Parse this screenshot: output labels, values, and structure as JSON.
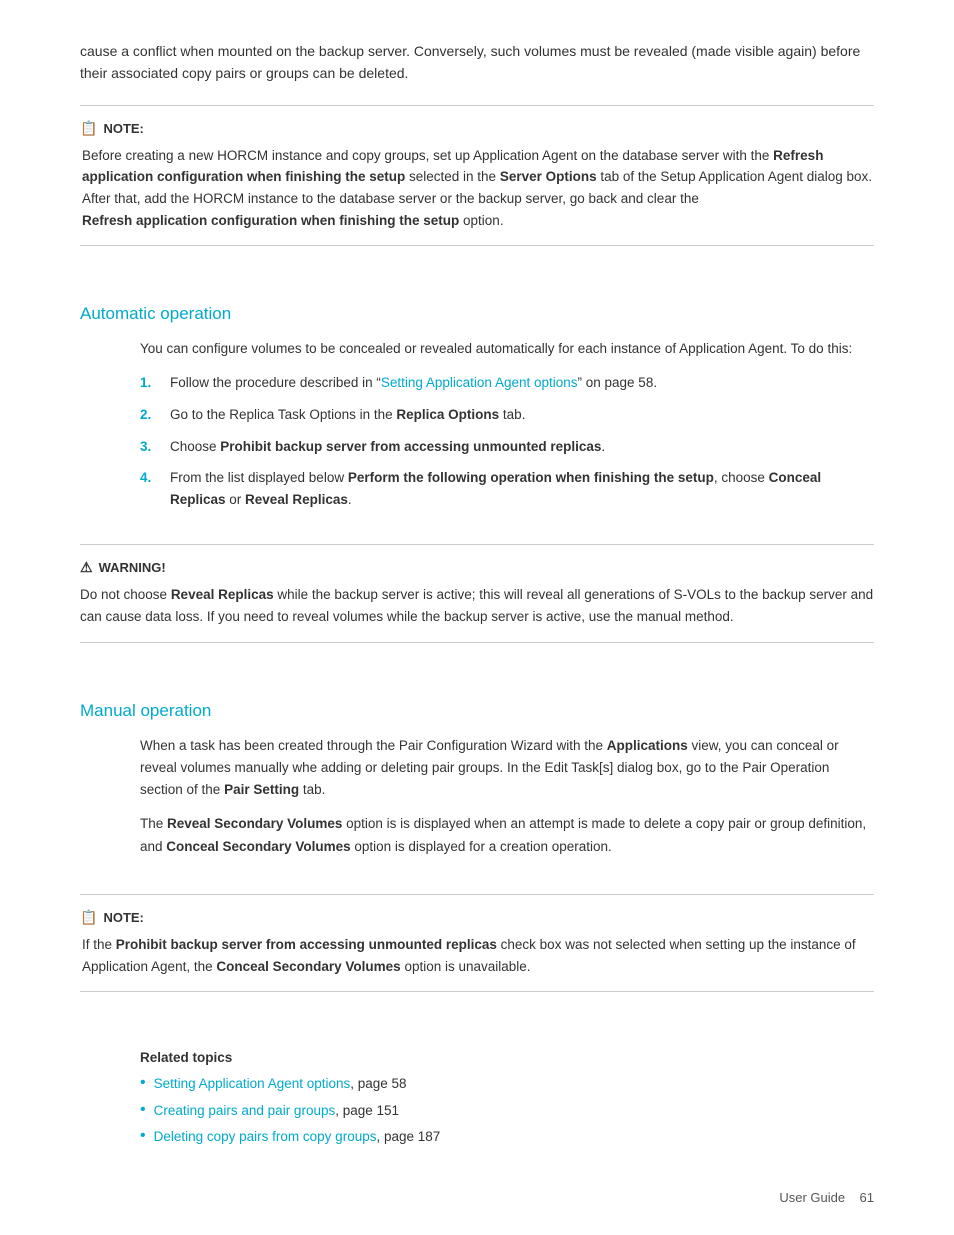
{
  "intro": {
    "text": "cause a conflict when mounted on the backup server. Conversely, such volumes must be revealed (made visible again) before their associated copy pairs or groups can be deleted."
  },
  "note1": {
    "header": "NOTE:",
    "body_parts": [
      {
        "text": "Before creating a new HORCM instance and copy groups, set up Application Agent on the database server with the "
      },
      {
        "bold": "Refresh application configuration when finishing the setup"
      },
      {
        "text": " selected in the "
      },
      {
        "bold": "Server Options"
      },
      {
        "text": " tab of the Setup Application Agent dialog box. After that, add the HORCM instance to the database server or the backup server, go back and clear the "
      },
      {
        "bold": "Refresh application configuration when finishing the setup"
      },
      {
        "text": " option."
      }
    ]
  },
  "automatic_operation": {
    "title": "Automatic operation",
    "intro": "You can configure volumes to be concealed or revealed automatically for each instance of Application Agent. To do this:",
    "steps": [
      {
        "num": "1.",
        "parts": [
          {
            "text": "Follow the procedure described in “"
          },
          {
            "link": "Setting Application Agent options"
          },
          {
            "text": "” on page 58."
          }
        ]
      },
      {
        "num": "2.",
        "parts": [
          {
            "text": "Go to the Replica Task Options in the "
          },
          {
            "bold": "Replica Options"
          },
          {
            "text": " tab."
          }
        ]
      },
      {
        "num": "3.",
        "parts": [
          {
            "text": "Choose "
          },
          {
            "bold": "Prohibit backup server from accessing unmounted replicas"
          },
          {
            "text": "."
          }
        ]
      },
      {
        "num": "4.",
        "parts": [
          {
            "text": "From the list displayed below "
          },
          {
            "bold": "Perform the following operation when finishing the setup"
          },
          {
            "text": ", choose "
          },
          {
            "bold": "Conceal Replicas"
          },
          {
            "text": " or "
          },
          {
            "bold": "Reveal Replicas"
          },
          {
            "text": "."
          }
        ]
      }
    ]
  },
  "warning1": {
    "header": "WARNING!",
    "body_parts": [
      {
        "text": "Do not choose "
      },
      {
        "bold": "Reveal Replicas"
      },
      {
        "text": " while the backup server is active; this will reveal all generations of S-VOLs to the backup server and can cause data loss. If you need to reveal volumes while the backup server is active, use the manual method."
      }
    ]
  },
  "manual_operation": {
    "title": "Manual operation",
    "para1_parts": [
      {
        "text": "When a task has been created through the Pair Configuration Wizard with the "
      },
      {
        "bold": "Applications"
      },
      {
        "text": " view, you can conceal or reveal volumes manually whe adding or deleting pair groups. In the Edit Task[s] dialog box, go to the Pair Operation section of the "
      },
      {
        "bold": "Pair Setting"
      },
      {
        "text": " tab."
      }
    ],
    "para2_parts": [
      {
        "text": "The "
      },
      {
        "bold": "Reveal Secondary Volumes"
      },
      {
        "text": " option is is displayed when an attempt is made to delete a copy pair or group definition, and "
      },
      {
        "bold": "Conceal Secondary Volumes"
      },
      {
        "text": " option is displayed for a creation operation."
      }
    ]
  },
  "note2": {
    "header": "NOTE:",
    "body_parts": [
      {
        "text": "If the "
      },
      {
        "bold": "Prohibit backup server from accessing unmounted replicas"
      },
      {
        "text": " check box was not selected when setting up the instance of Application Agent, the "
      },
      {
        "bold": "Conceal Secondary Volumes"
      },
      {
        "text": " option is unavailable."
      }
    ]
  },
  "related_topics": {
    "title": "Related topics",
    "items": [
      {
        "link": "Setting Application Agent options",
        "text": ", page 58"
      },
      {
        "link": "Creating pairs and pair groups",
        "text": ", page 151"
      },
      {
        "link": "Deleting copy pairs from copy groups",
        "text": ", page 187"
      }
    ]
  },
  "footer": {
    "label": "User Guide",
    "page": "61"
  }
}
